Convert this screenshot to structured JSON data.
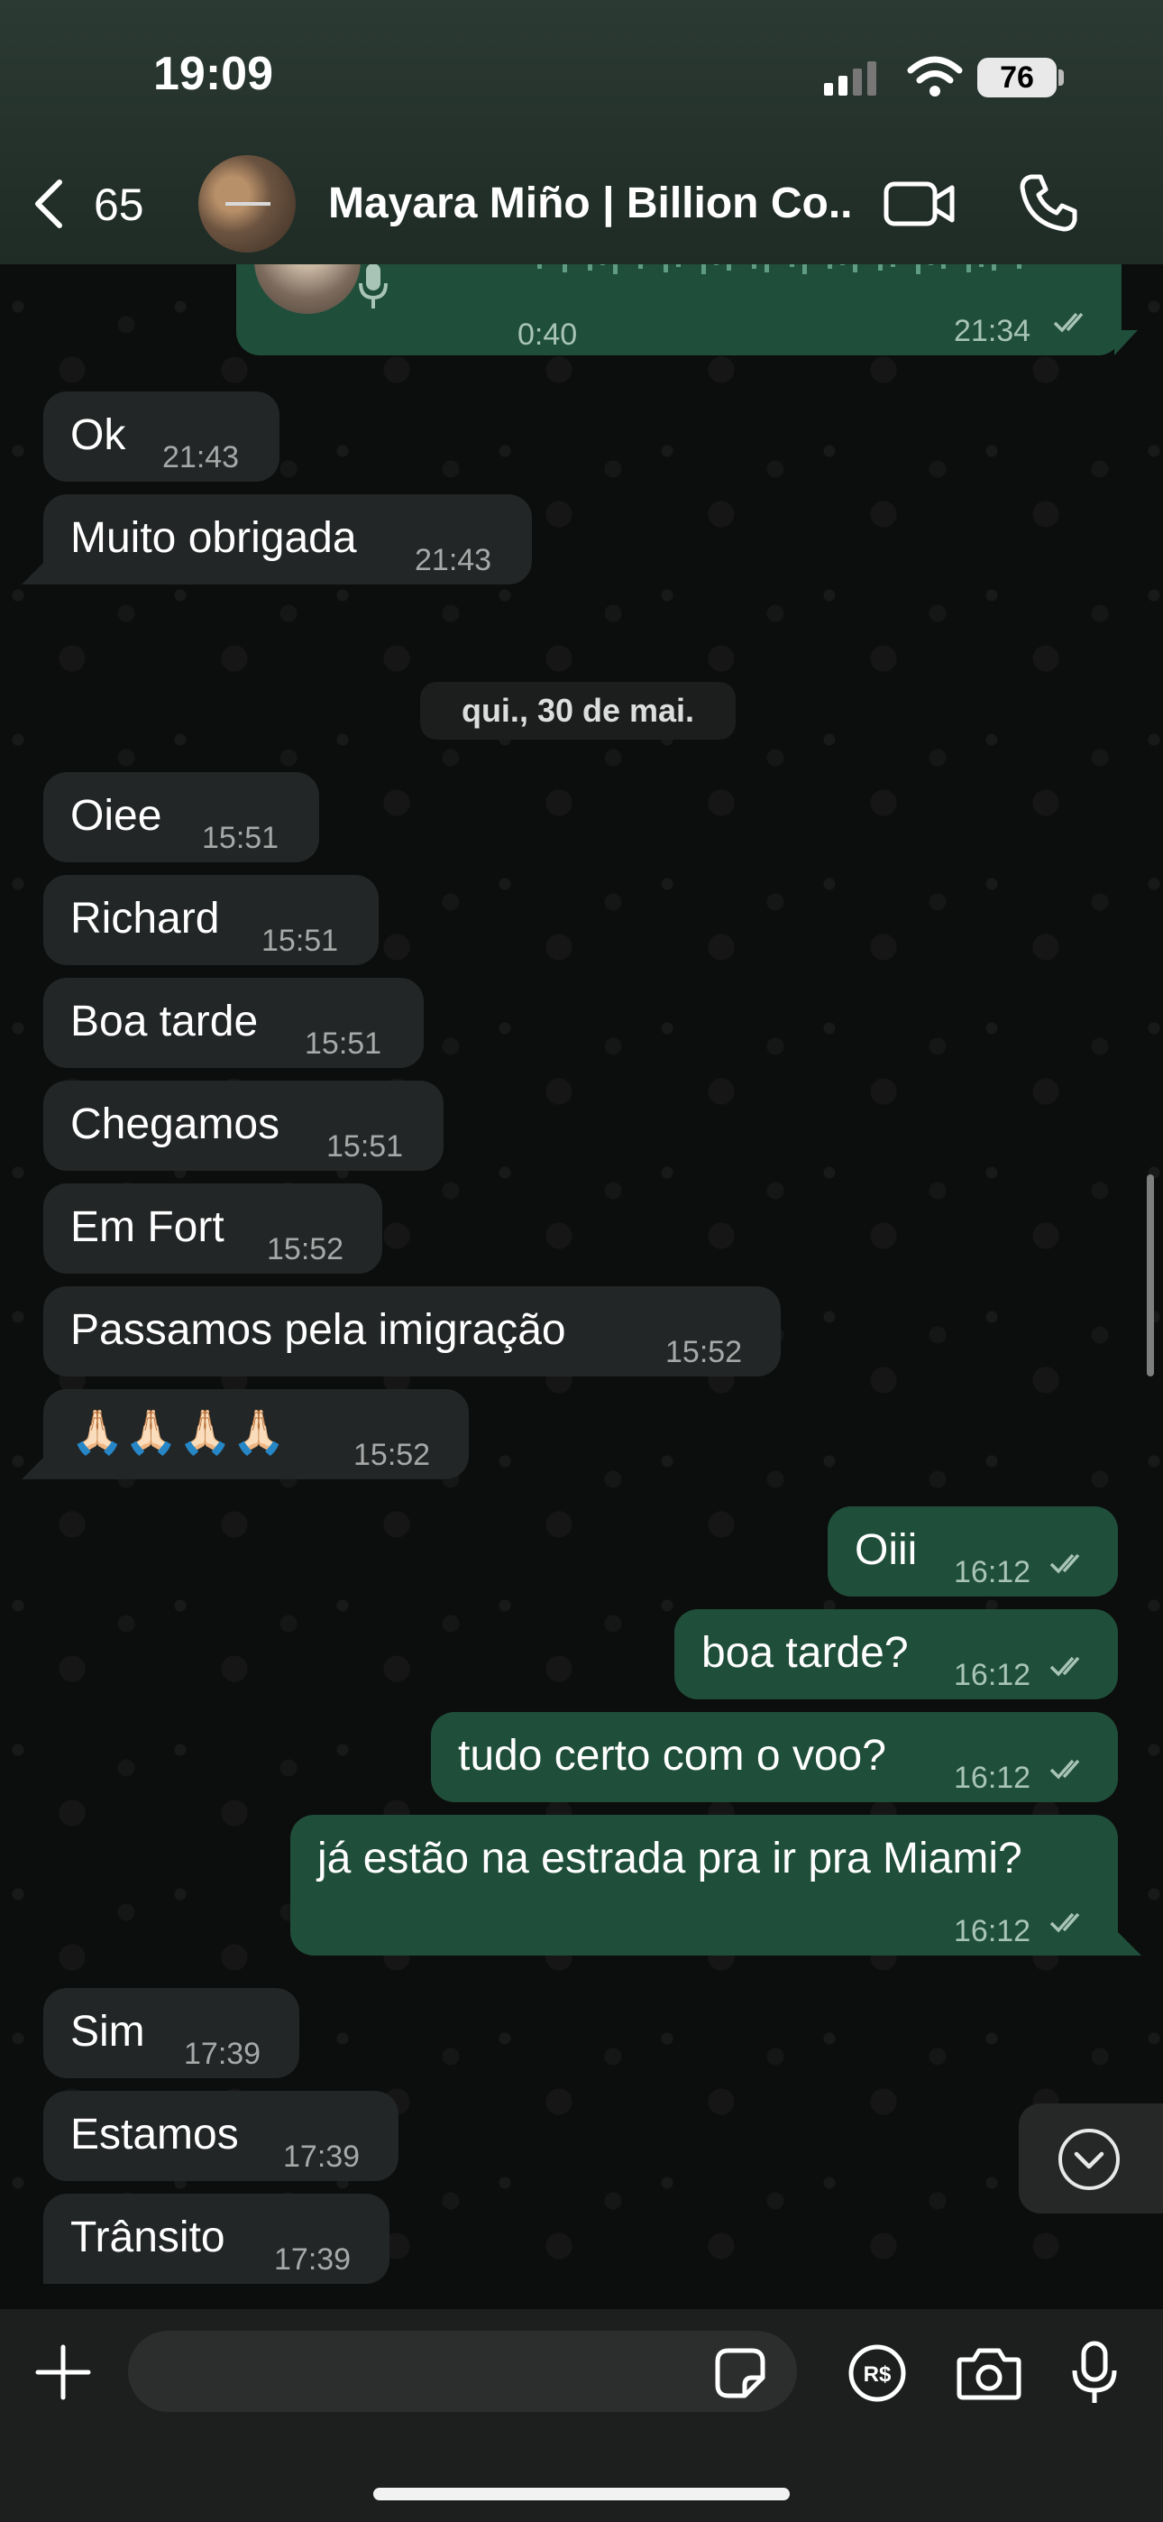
{
  "status_bar": {
    "time": "19:09",
    "battery": "76"
  },
  "header": {
    "back_count": "65",
    "contact_name": "Mayara Miño | Billion Co..."
  },
  "voice_message": {
    "duration": "0:40",
    "time": "21:34"
  },
  "messages_before": [
    {
      "text": "Ok",
      "time": "21:43"
    },
    {
      "text": "Muito obrigada",
      "time": "21:43"
    }
  ],
  "date_separator": "qui., 30 de mai.",
  "incoming_1": [
    {
      "text": "Oiee",
      "time": "15:51"
    },
    {
      "text": "Richard",
      "time": "15:51"
    },
    {
      "text": "Boa tarde",
      "time": "15:51"
    },
    {
      "text": "Chegamos",
      "time": "15:51"
    },
    {
      "text": "Em Fort",
      "time": "15:52"
    },
    {
      "text": "Passamos pela imigração",
      "time": "15:52"
    },
    {
      "text": "🙏🏻🙏🏻🙏🏻🙏🏻",
      "time": "15:52"
    }
  ],
  "outgoing": [
    {
      "text": "Oiii",
      "time": "16:12"
    },
    {
      "text": "boa tarde?",
      "time": "16:12"
    },
    {
      "text": "tudo certo com o voo?",
      "time": "16:12"
    },
    {
      "text": "já estão na estrada pra ir pra Miami?",
      "time": "16:12"
    }
  ],
  "incoming_2": [
    {
      "text": "Sim",
      "time": "17:39"
    },
    {
      "text": "Estamos",
      "time": "17:39"
    },
    {
      "text": "Trânsito",
      "time": "17:39"
    }
  ],
  "composer": {
    "placeholder": ""
  },
  "colors": {
    "outgoing_bubble": "#1f4e3a",
    "incoming_bubble": "#232626",
    "header": "#24312b"
  }
}
